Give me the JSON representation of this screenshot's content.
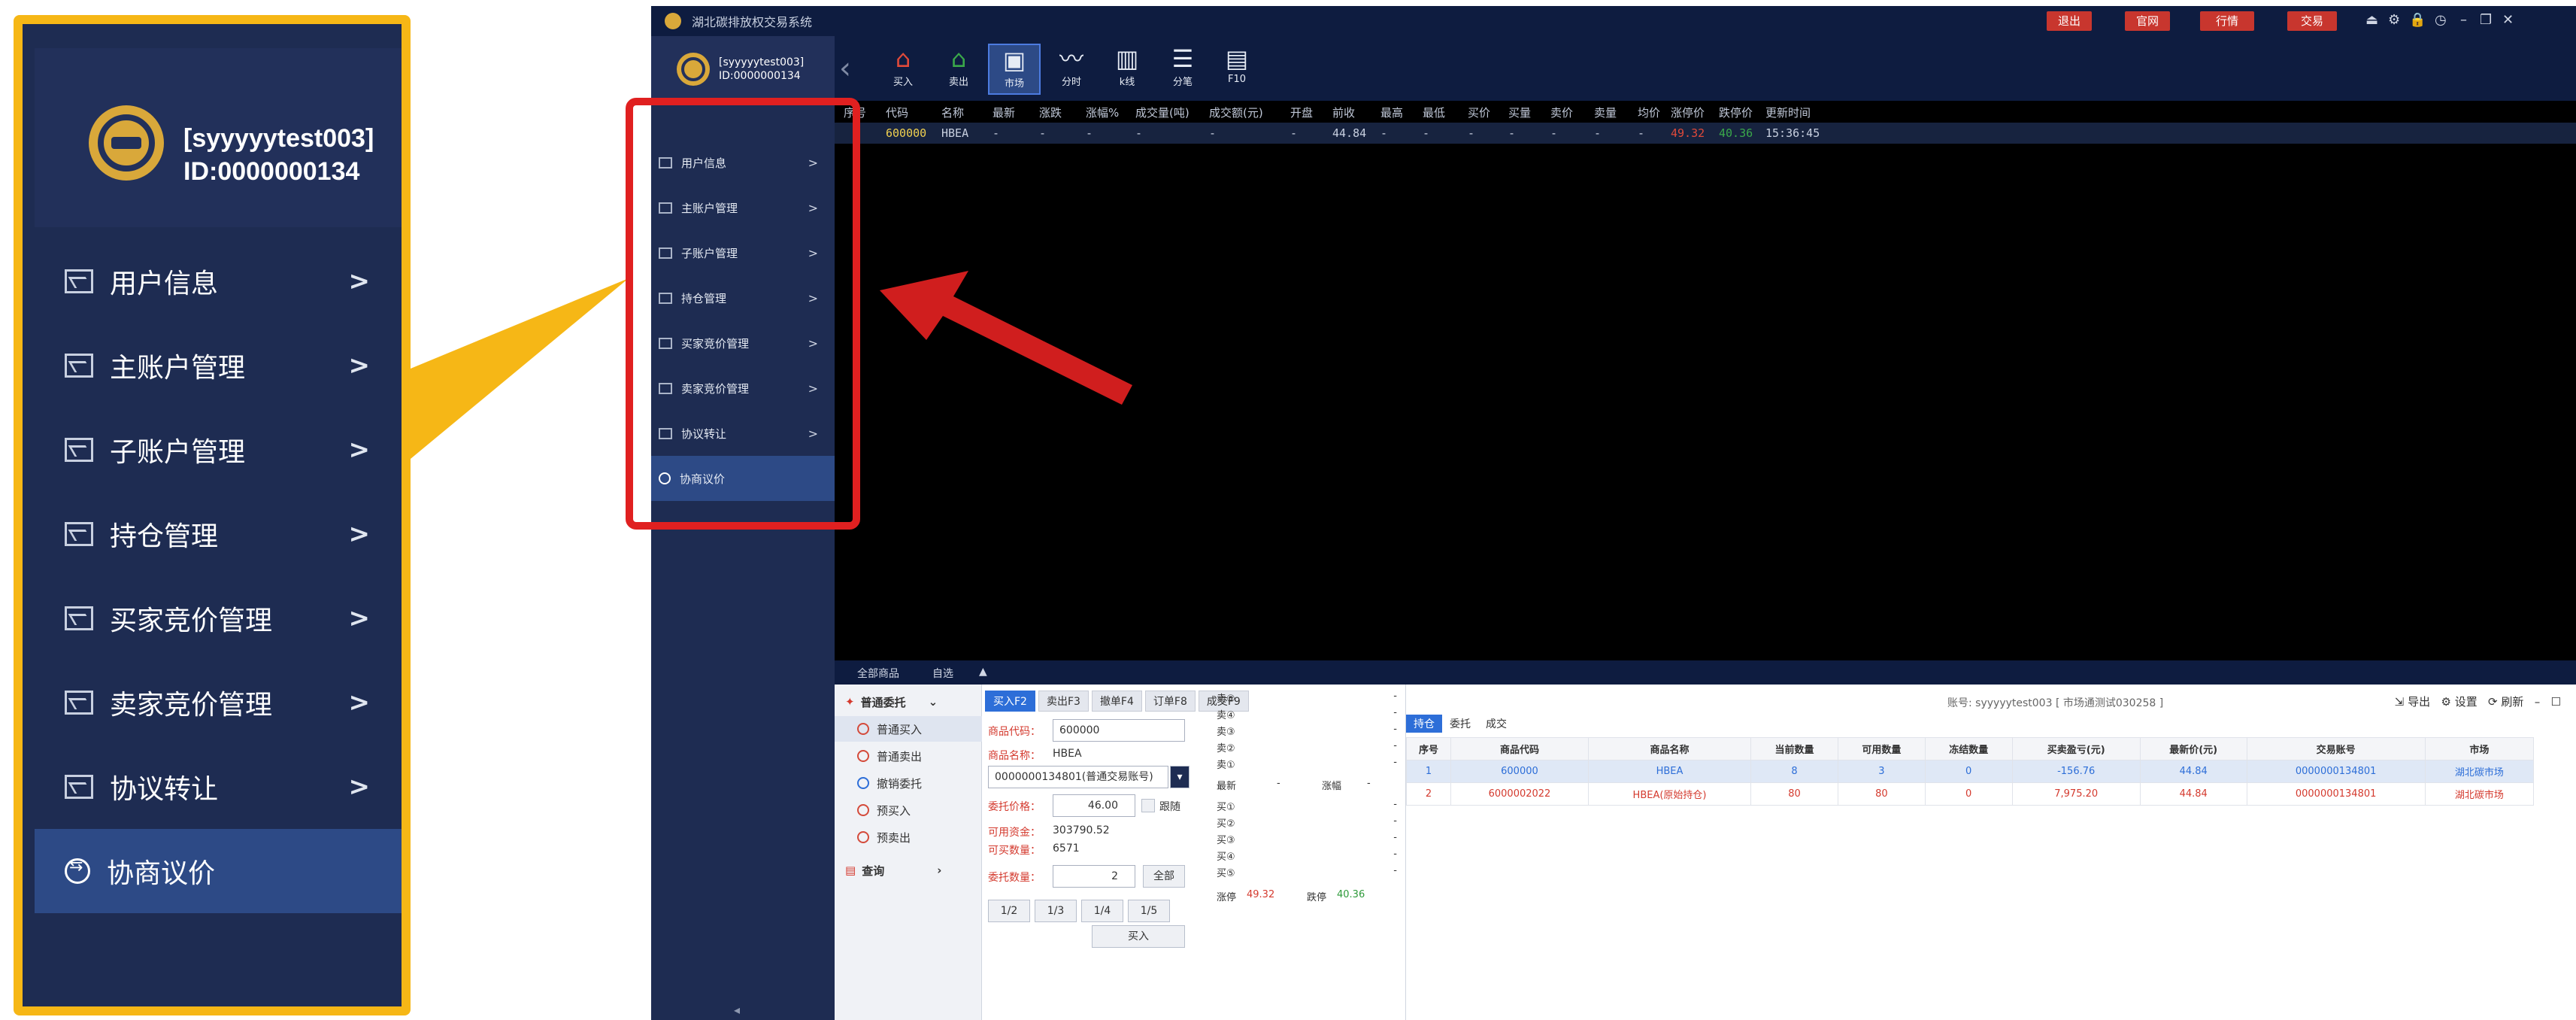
{
  "zoom": {
    "username": "[syyyyytest003]",
    "user_id": "ID:0000000134",
    "items": [
      {
        "label": "用户信息"
      },
      {
        "label": "主账户管理"
      },
      {
        "label": "子账户管理"
      },
      {
        "label": "持仓管理"
      },
      {
        "label": "买家竞价管理"
      },
      {
        "label": "卖家竞价管理"
      },
      {
        "label": "协议转让"
      },
      {
        "label": "协商议价"
      }
    ],
    "chevron": ">"
  },
  "app": {
    "title": "湖北碳排放权交易系统",
    "top_buttons": [
      "退出",
      "官网",
      "行情",
      "交易"
    ],
    "window_icons": [
      "⏏",
      "⚙",
      "🔒",
      "◷",
      "–",
      "❐",
      "✕"
    ],
    "toolbar": [
      {
        "label": "买入",
        "glyph": "⌂"
      },
      {
        "label": "卖出",
        "glyph": "⌂"
      },
      {
        "label": "市场",
        "glyph": "▣"
      },
      {
        "label": "分时",
        "glyph": "〰"
      },
      {
        "label": "k线",
        "glyph": "▥"
      },
      {
        "label": "分笔",
        "glyph": "☰"
      },
      {
        "label": "F10",
        "glyph": "▤"
      }
    ],
    "quote_columns": [
      "序号",
      "代码",
      "名称",
      "最新",
      "涨跌",
      "涨幅%",
      "成交量(吨)",
      "成交额(元)",
      "开盘",
      "前收",
      "最高",
      "最低",
      "买价",
      "买量",
      "卖价",
      "卖量",
      "均价",
      "涨停价",
      "跌停价",
      "更新时间"
    ],
    "quote_row": [
      "",
      "600000",
      "HBEA",
      "-",
      "-",
      "-",
      "-",
      "-",
      "-",
      "44.84",
      "-",
      "-",
      "-",
      "-",
      "-",
      "-",
      "-",
      "49.32",
      "40.36",
      "15:36:45"
    ],
    "lower_tabs": [
      "全部商品",
      "自选",
      "▲"
    ],
    "order_menu_title": "普通委托",
    "order_menu": [
      "普通买入",
      "普通卖出",
      "撤销委托",
      "预买入",
      "预卖出"
    ],
    "query_label": "查询",
    "order_tabs": [
      "买入F2",
      "卖出F3",
      "撤单F4",
      "订单F8",
      "成交F9"
    ],
    "form": {
      "code_label": "商品代码：",
      "code_value": "600000",
      "name_label": "商品名称：",
      "name_value": "HBEA",
      "account_value": "0000000134801(普通交易账号)",
      "price_label": "委托价格：",
      "price_value": "46.00",
      "follow_label": "跟随",
      "funds_label": "可用资金：",
      "funds_value": "303790.52",
      "buyable_label": "可买数量：",
      "buyable_value": "6571",
      "qty_label": "委托数量：",
      "qty_value": "2",
      "all_btn": "全部",
      "fractions": [
        "1/2",
        "1/3",
        "1/4",
        "1/5"
      ],
      "buy_btn": "买入"
    },
    "book": {
      "sell": [
        "卖⑤",
        "卖④",
        "卖③",
        "卖②",
        "卖①"
      ],
      "buy": [
        "买①",
        "买②",
        "买③",
        "买④",
        "买⑤"
      ],
      "dash": "-",
      "latest_label": "最新",
      "change_label": "涨幅",
      "limit_up_label": "涨停",
      "limit_up": "49.32",
      "limit_down_label": "跌停",
      "limit_down": "40.36"
    },
    "account_info": "账号: syyyyytest003 [ 市场通测试030258 ]",
    "tools": [
      "导出",
      "设置",
      "刷新"
    ],
    "hold_tabs": [
      "持仓",
      "委托",
      "成交"
    ],
    "hold_columns": [
      "序号",
      "商品代码",
      "商品名称",
      "当前数量",
      "可用数量",
      "冻结数量",
      "买卖盈亏(元)",
      "最新价(元)",
      "交易账号",
      "市场"
    ],
    "hold_rows": [
      [
        "1",
        "600000",
        "HBEA",
        "8",
        "3",
        "0",
        "-156.76",
        "44.84",
        "0000000134801",
        "湖北碳市场"
      ],
      [
        "2",
        "6000002022",
        "HBEA(原始持仓)",
        "80",
        "80",
        "0",
        "7,975.20",
        "44.84",
        "0000000134801",
        "湖北碳市场"
      ]
    ],
    "colors": {
      "accent": "#f6b716",
      "highlight": "#e02020",
      "sidebar": "#1e2c52",
      "active": "#2d4a86"
    }
  }
}
